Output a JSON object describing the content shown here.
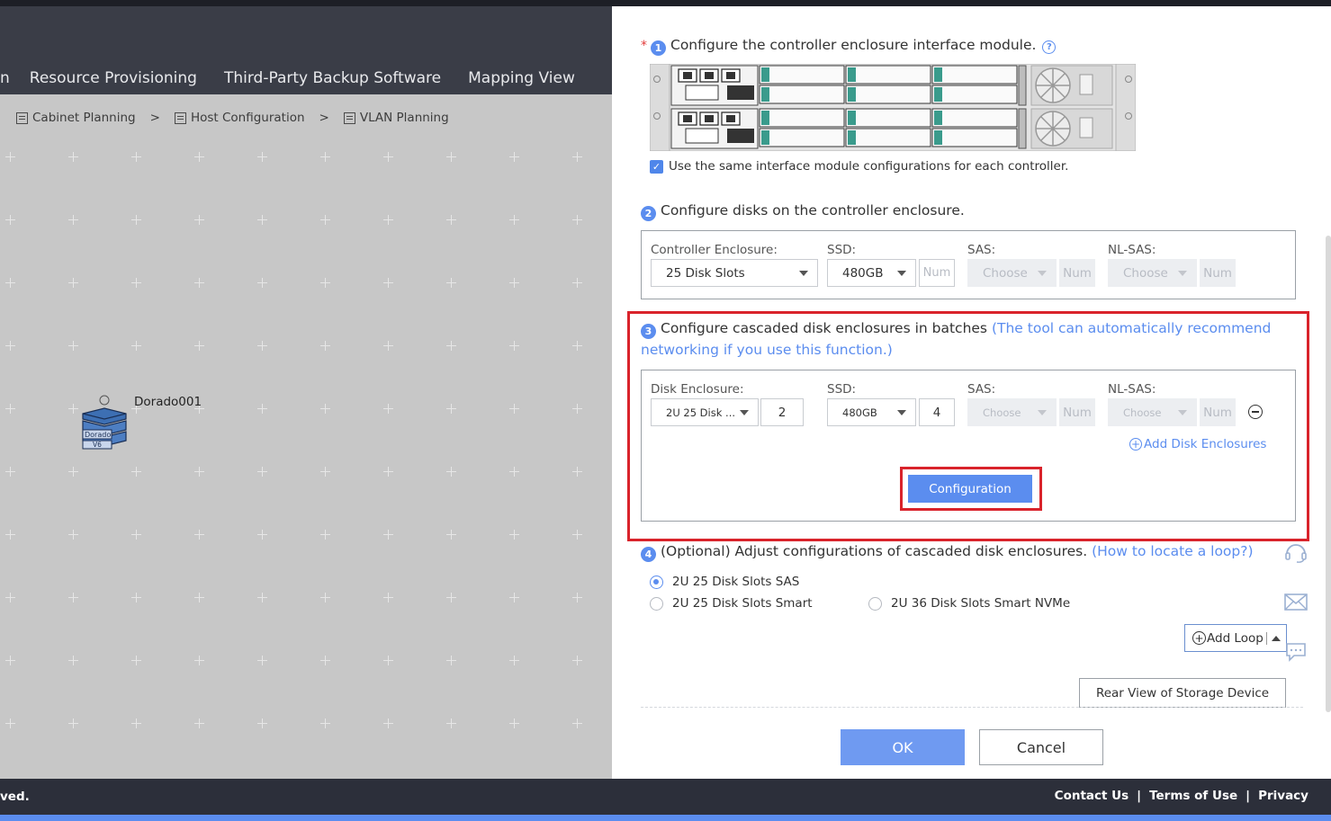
{
  "app": {
    "nav_items": [
      "n",
      "Resource Provisioning",
      "Third-Party Backup Software",
      "Mapping View"
    ],
    "breadcrumb": [
      {
        "label": "Cabinet Planning"
      },
      {
        "label": "Host Configuration"
      },
      {
        "label": "VLAN Planning"
      }
    ],
    "breadcrumb_sep": ">",
    "device": {
      "name": "Dorado001",
      "badge_line1": "Dorado",
      "badge_line2": "V6"
    }
  },
  "footer": {
    "copyright_fragment": "ved.",
    "links": [
      "Contact Us",
      "Terms of Use",
      "Privacy"
    ],
    "sep": "|"
  },
  "panel": {
    "step1": {
      "num": "1",
      "required_mark": "*",
      "title": "Configure the controller enclosure interface module.",
      "help": "?",
      "same_config_label": "Use the same interface module configurations for each controller.",
      "same_config_checked": true,
      "check_mark": "✓"
    },
    "step2": {
      "num": "2",
      "title": "Configure disks on the controller enclosure.",
      "enclosure_label": "Controller Enclosure:",
      "enclosure_value": "25 Disk Slots",
      "ssd_label": "SSD:",
      "ssd_value": "480GB",
      "ssd_num_placeholder": "Num",
      "sas_label": "SAS:",
      "sas_value": "Choose",
      "sas_num_placeholder": "Num",
      "nlsas_label": "NL-SAS:",
      "nlsas_value": "Choose",
      "nlsas_num_placeholder": "Num"
    },
    "step3": {
      "num": "3",
      "title": "Configure cascaded disk enclosures in batches",
      "hint_line1": "(The tool can automatically recommend",
      "hint_line2": "networking if you use this function.)",
      "disk_enclosure_label": "Disk Enclosure:",
      "disk_enclosure_value": "2U 25 Disk ...",
      "disk_enclosure_count": "2",
      "ssd_label": "SSD:",
      "ssd_value": "480GB",
      "ssd_count": "4",
      "sas_label": "SAS:",
      "sas_value": "Choose",
      "sas_num_placeholder": "Num",
      "nlsas_label": "NL-SAS:",
      "nlsas_value": "Choose",
      "nlsas_num_placeholder": "Num",
      "add_enclosures_label": "Add Disk Enclosures",
      "add_symbol": "+",
      "configuration_button": "Configuration"
    },
    "step4": {
      "num": "4",
      "title": "(Optional) Adjust configurations of cascaded disk enclosures.",
      "hint": "(How to locate a loop?)",
      "options": [
        {
          "label": "2U 25 Disk Slots SAS",
          "selected": true
        },
        {
          "label": "2U 25 Disk Slots Smart",
          "selected": false
        },
        {
          "label": "2U 36 Disk Slots Smart NVMe",
          "selected": false
        }
      ],
      "add_loop_label": "Add Loop",
      "add_symbol": "+",
      "rear_view_button": "Rear View of Storage Device"
    },
    "ok_button": "OK",
    "cancel_button": "Cancel"
  },
  "colors": {
    "accent": "#5b8def",
    "highlight_red": "#d9232b",
    "navbar": "#3a3d47",
    "footer": "#2c2f3a"
  },
  "icons": [
    "cabinet-icon",
    "host-icon",
    "vlan-icon",
    "storage-device-icon",
    "help-icon",
    "checkbox-checked-icon",
    "remove-row-icon",
    "add-circle-icon",
    "caret-down-icon",
    "caret-up-icon",
    "headset-icon",
    "mail-icon",
    "chat-icon"
  ]
}
